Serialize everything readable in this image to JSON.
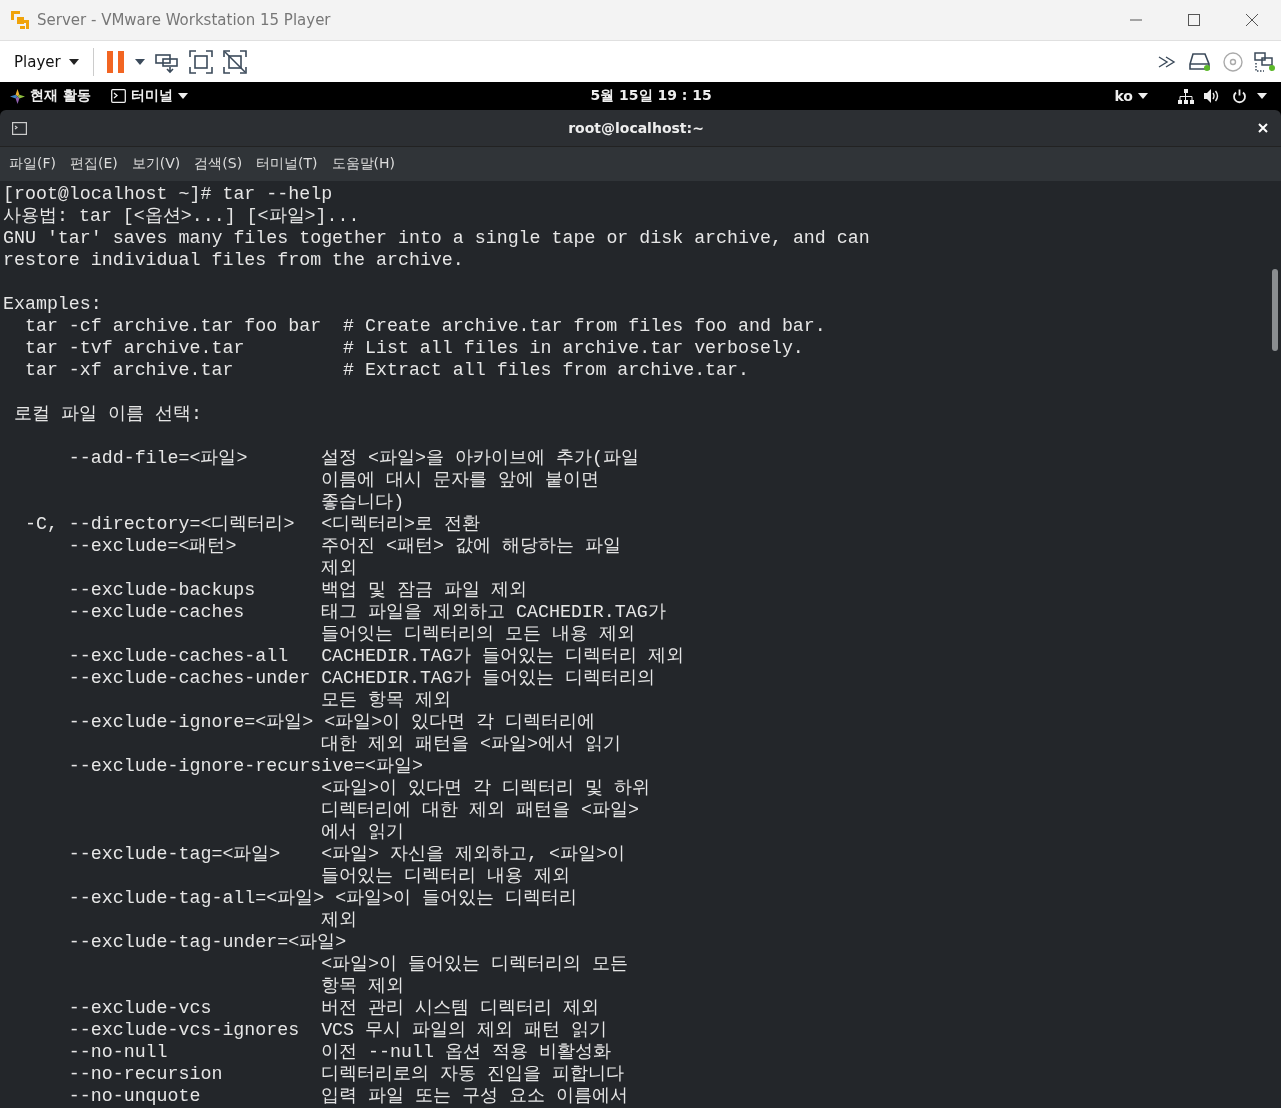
{
  "window": {
    "title": "Server - VMware Workstation 15 Player"
  },
  "toolbar": {
    "player_menu": "Player"
  },
  "gnome_bar": {
    "activities": "현재 활동",
    "app_menu": "터미널",
    "clock": "5월 15일  19 : 15",
    "input_method": "ko"
  },
  "terminal": {
    "title": "root@localhost:~",
    "menu": [
      "파일(F)",
      "편집(E)",
      "보기(V)",
      "검색(S)",
      "터미널(T)",
      "도움말(H)"
    ],
    "lines": [
      {
        "kind": "plain",
        "text": "[root@localhost ~]# tar --help"
      },
      {
        "kind": "plain",
        "text": "사용법: tar [<옵션>...] [<파일>]..."
      },
      {
        "kind": "plain",
        "text": "GNU 'tar' saves many files together into a single tape or disk archive, and can"
      },
      {
        "kind": "plain",
        "text": "restore individual files from the archive."
      },
      {
        "kind": "blank"
      },
      {
        "kind": "plain",
        "text": "Examples:"
      },
      {
        "kind": "example",
        "command": "tar -cf archive.tar foo bar",
        "comment": "# Create archive.tar from files foo and bar."
      },
      {
        "kind": "example",
        "command": "tar -tvf archive.tar",
        "comment": "# List all files in archive.tar verbosely."
      },
      {
        "kind": "example",
        "command": "tar -xf archive.tar",
        "comment": "# Extract all files from archive.tar."
      },
      {
        "kind": "blank"
      },
      {
        "kind": "heading",
        "text": "로컬 파일 이름 선택:"
      },
      {
        "kind": "blank"
      },
      {
        "kind": "option",
        "option": "--add-file=<파일>",
        "description": "설정 <파일>을 아카이브에 추가(파일"
      },
      {
        "kind": "cont",
        "description": "이름에 대시 문자를 앞에 붙이면"
      },
      {
        "kind": "cont",
        "description": "좋습니다)"
      },
      {
        "kind": "option",
        "short": "-C,",
        "option": "--directory=<디렉터리>",
        "description": "<디렉터리>로 전환"
      },
      {
        "kind": "option",
        "option": "--exclude=<패턴>",
        "description": "주어진 <패턴> 값에 해당하는 파일"
      },
      {
        "kind": "cont",
        "description": "제외"
      },
      {
        "kind": "option",
        "option": "--exclude-backups",
        "description": "백업 및 잠금 파일 제외"
      },
      {
        "kind": "option",
        "option": "--exclude-caches",
        "description": "태그 파일을 제외하고 CACHEDIR.TAG가"
      },
      {
        "kind": "cont",
        "description": "들어잇는 디렉터리의 모든 내용 제외"
      },
      {
        "kind": "option",
        "option": "--exclude-caches-all",
        "description": "CACHEDIR.TAG가 들어있는 디렉터리 제외"
      },
      {
        "kind": "option",
        "option": "--exclude-caches-under",
        "description": "CACHEDIR.TAG가 들어있는 디렉터리의"
      },
      {
        "kind": "cont",
        "description": "모든 항목 제외"
      },
      {
        "kind": "option",
        "option": "--exclude-ignore=<파일>",
        "description": "<파일>이 있다면 각 디렉터리에"
      },
      {
        "kind": "cont",
        "description": "대한 제외 패턴을 <파일>에서 읽기"
      },
      {
        "kind": "option",
        "option": "--exclude-ignore-recursive=<파일>"
      },
      {
        "kind": "cont",
        "description": "<파일>이 있다면 각 디렉터리 및 하위"
      },
      {
        "kind": "cont",
        "description": "디렉터리에 대한 제외 패턴을 <파일>"
      },
      {
        "kind": "cont",
        "description": "에서 읽기"
      },
      {
        "kind": "option",
        "option": "--exclude-tag=<파일>",
        "description": "<파일> 자신을 제외하고, <파일>이"
      },
      {
        "kind": "cont",
        "description": "들어있는 디렉터리 내용 제외"
      },
      {
        "kind": "option",
        "option": "--exclude-tag-all=<파일>",
        "description": "<파일>이 들어있는 디렉터리"
      },
      {
        "kind": "cont",
        "description": "제외"
      },
      {
        "kind": "option",
        "option": "--exclude-tag-under=<파일>"
      },
      {
        "kind": "cont",
        "description": "<파일>이 들어있는 디렉터리의 모든"
      },
      {
        "kind": "cont",
        "description": "항목 제외"
      },
      {
        "kind": "option",
        "option": "--exclude-vcs",
        "description": "버전 관리 시스템 디렉터리 제외"
      },
      {
        "kind": "option",
        "option": "--exclude-vcs-ignores",
        "description": "VCS 무시 파일의 제외 패턴 읽기"
      },
      {
        "kind": "option",
        "option": "--no-null",
        "description": "이전 --null 옵션 적용 비활성화"
      },
      {
        "kind": "option",
        "option": "--no-recursion",
        "description": "디렉터리로의 자동 진입을 피합니다"
      },
      {
        "kind": "option",
        "option": "--no-unquote",
        "description": "입력 파일 또는 구성 요소 이름에서"
      }
    ]
  }
}
